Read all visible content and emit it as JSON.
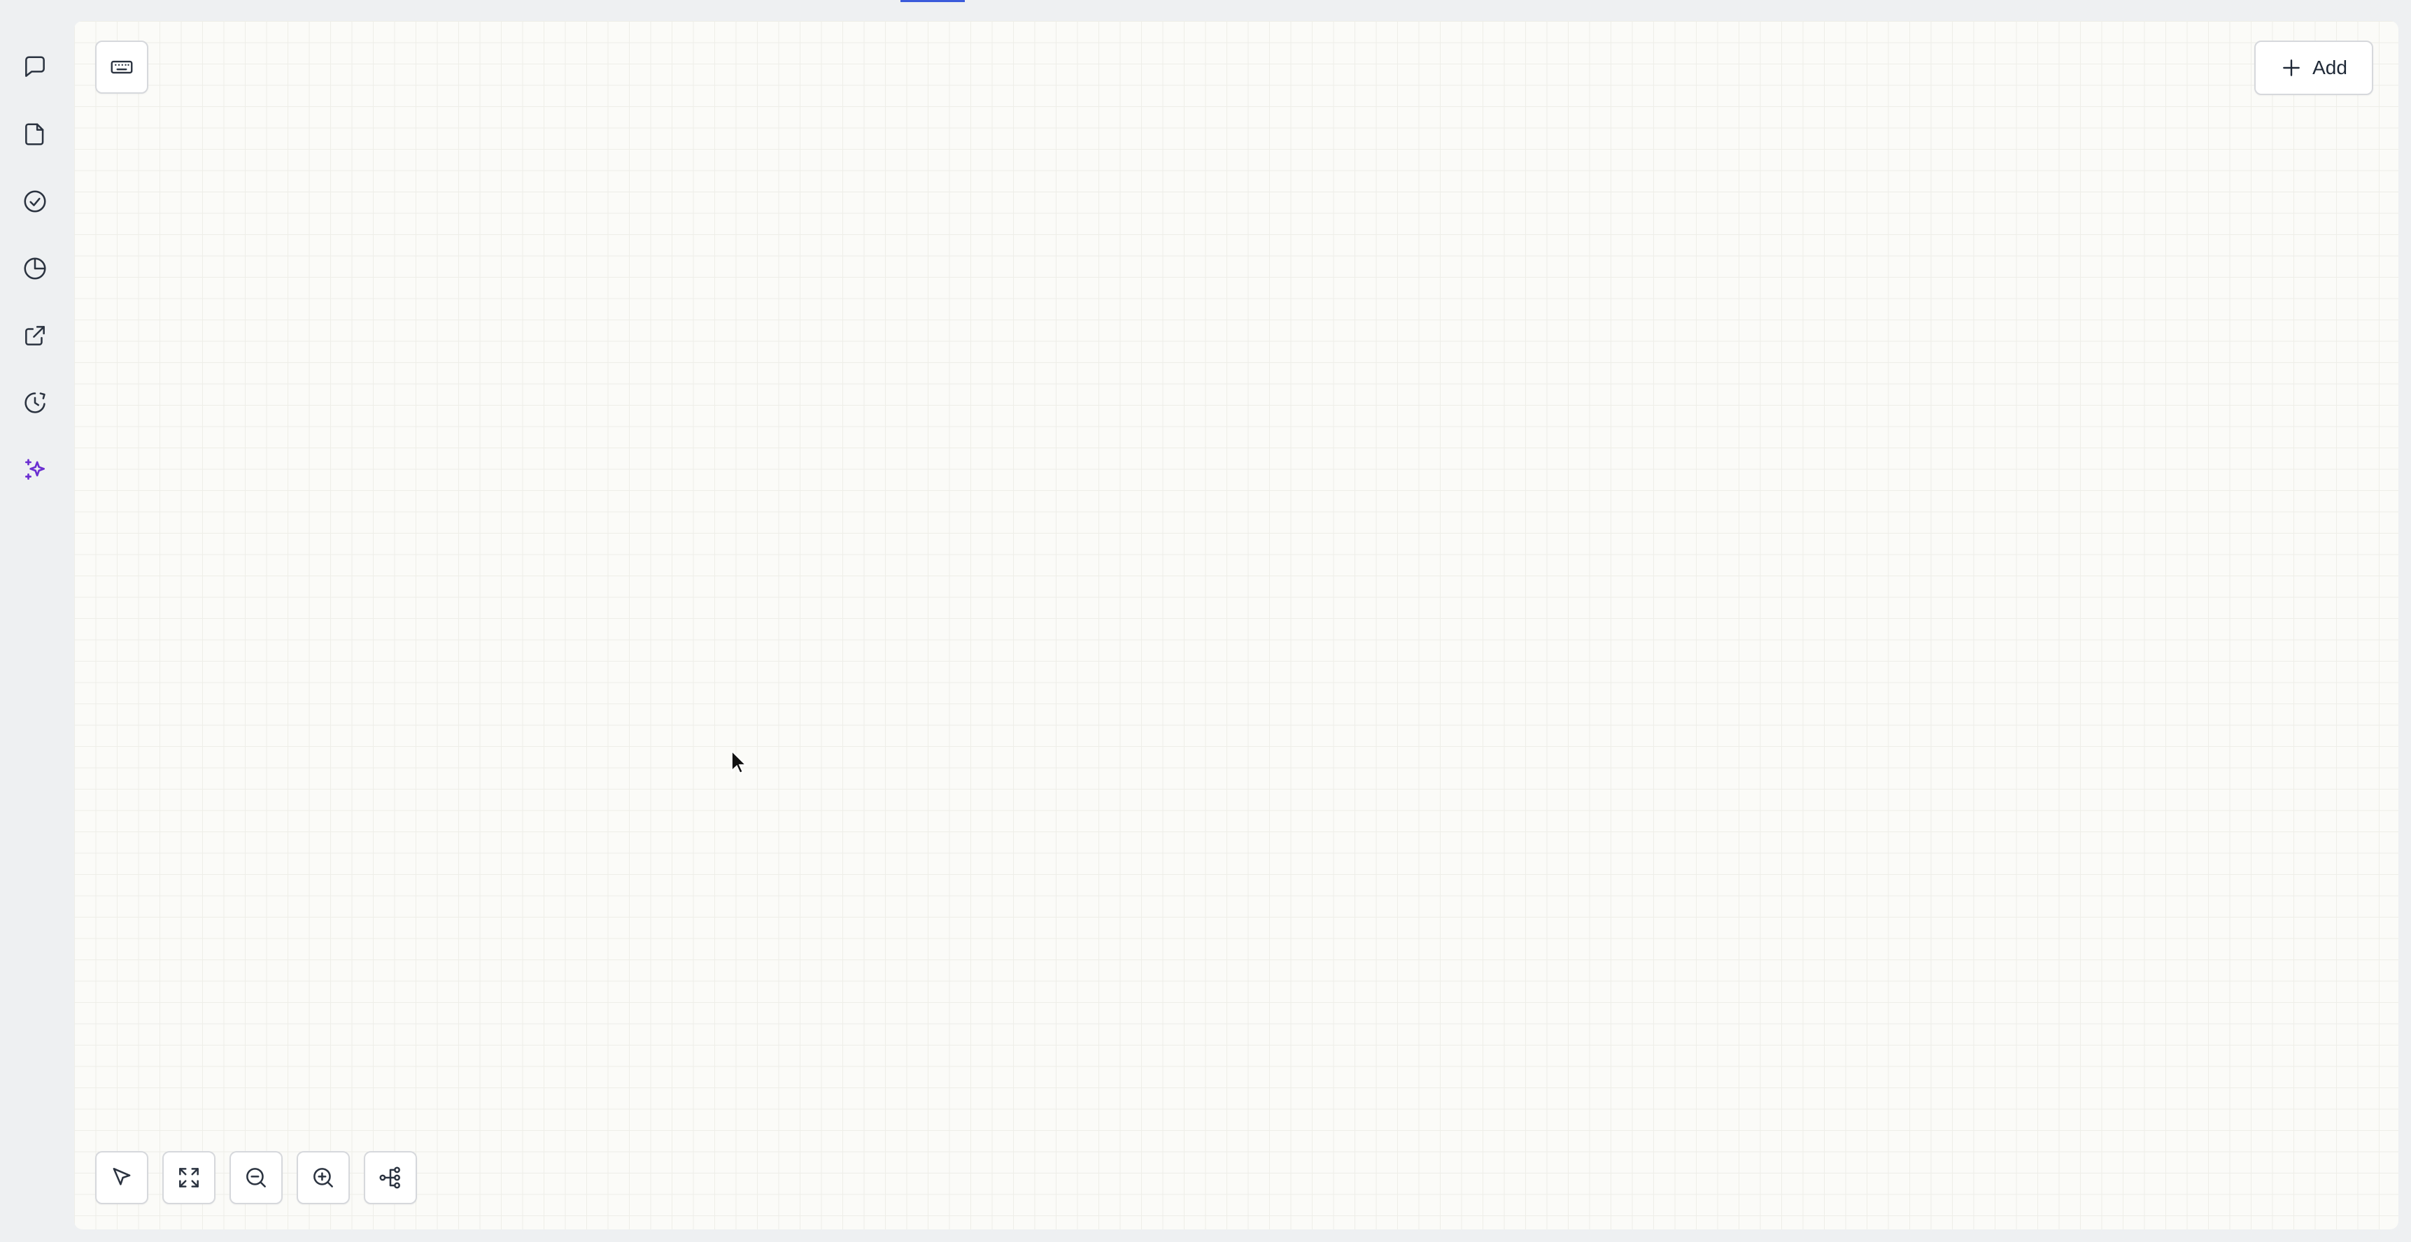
{
  "toolbar": {
    "add_label": "Add"
  },
  "sidebar": {
    "items": [
      {
        "icon": "chat-bubble-icon"
      },
      {
        "icon": "file-icon"
      },
      {
        "icon": "check-circle-icon"
      },
      {
        "icon": "pie-chart-icon"
      },
      {
        "icon": "external-link-icon"
      },
      {
        "icon": "history-icon"
      },
      {
        "icon": "sparkles-icon",
        "active": true
      }
    ]
  },
  "colors": {
    "accent": "#6b2fd1",
    "icon": "#2b3340",
    "canvas_bg": "#fbfbf8",
    "top_indicator": "#3b5bdb"
  }
}
